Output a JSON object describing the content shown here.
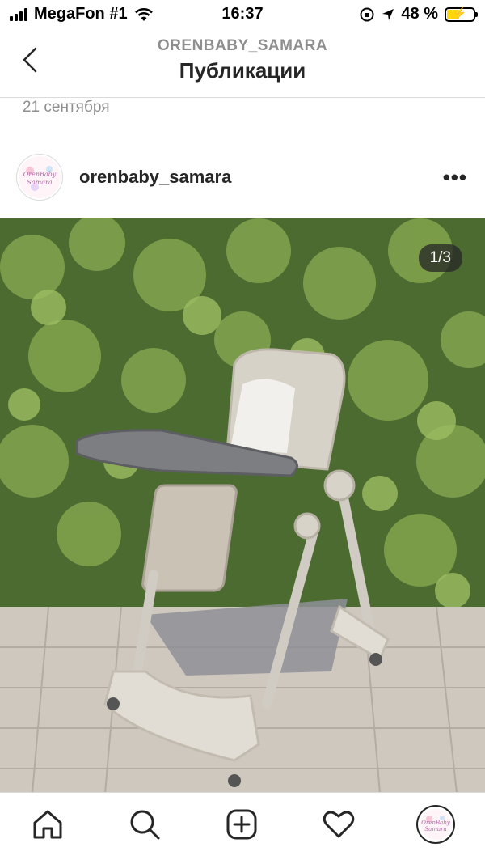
{
  "status_bar": {
    "carrier": "MegaFon #1",
    "time": "16:37",
    "battery": "48 %",
    "battery_level": 0.48
  },
  "nav": {
    "account": "ORENBABY_SAMARA",
    "title": "Публикации"
  },
  "post": {
    "date": "21 сентября",
    "username": "orenbaby_samara",
    "image_counter": "1/3",
    "avatar_text": [
      "OrenBaby",
      "Samara"
    ]
  },
  "tabbar": {
    "items": [
      "home-icon",
      "search-icon",
      "new-post-icon",
      "heart-icon",
      "profile-icon"
    ]
  },
  "colors": {
    "text": "#262626",
    "muted": "#8e8e8e",
    "border": "#dbdbdb",
    "battery": "#ffd60a"
  }
}
